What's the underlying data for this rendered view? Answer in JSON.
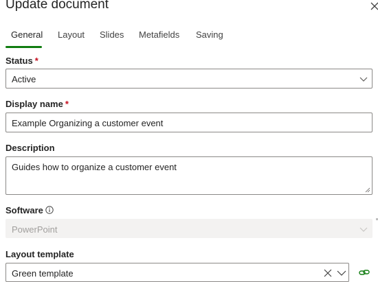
{
  "dialog": {
    "title": "Update document"
  },
  "tabs": [
    {
      "label": "General",
      "active": true
    },
    {
      "label": "Layout"
    },
    {
      "label": "Slides"
    },
    {
      "label": "Metafields"
    },
    {
      "label": "Saving"
    }
  ],
  "colors": {
    "accent": "#107c10",
    "required": "#c50f1f",
    "link_icon": "#107c10",
    "border": "#8a8886",
    "disabled_bg": "#f3f2f1"
  },
  "icons": {
    "close": "close-icon",
    "chevron": "chevron-down-icon",
    "info": "info-icon",
    "clear": "clear-icon",
    "link": "link-icon"
  },
  "form": {
    "status": {
      "label": "Status",
      "required_mark": "*",
      "value": "Active"
    },
    "display_name": {
      "label": "Display name",
      "required_mark": "*",
      "value": "Example Organizing a customer event"
    },
    "description": {
      "label": "Description",
      "value": "Guides how to organize a customer event"
    },
    "software": {
      "label": "Software",
      "value": "PowerPoint",
      "disabled": true
    },
    "layout_template": {
      "label": "Layout template",
      "value": "Green template"
    }
  }
}
